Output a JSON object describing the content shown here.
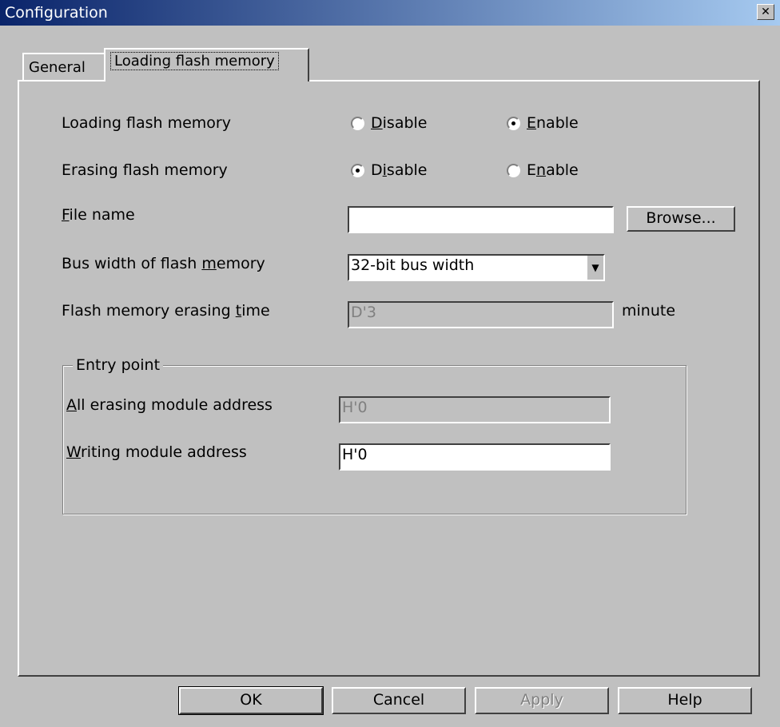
{
  "window": {
    "title": "Configuration",
    "close_glyph": "✕"
  },
  "tabs": {
    "general": "General",
    "loading_flash": "Loading flash memory"
  },
  "loading_flash_memory": {
    "label": "Loading flash memory",
    "options": {
      "disable": "Disable",
      "enable": "Enable"
    },
    "selected": "Enable"
  },
  "erasing_flash_memory": {
    "label": "Erasing flash memory",
    "options": {
      "disable": "Disable",
      "enable": "Enable"
    },
    "selected": "Disable"
  },
  "file_name": {
    "label": "File name",
    "value": "",
    "browse_label": "Browse..."
  },
  "bus_width": {
    "label": "Bus width of flash memory",
    "value": "32-bit bus width"
  },
  "erasing_time": {
    "label": "Flash memory erasing time",
    "value": "D'3",
    "unit": "minute"
  },
  "entry_point": {
    "title": "Entry point",
    "all_erasing_label": "All erasing module address",
    "all_erasing_value": "H'0",
    "writing_label": "Writing module address",
    "writing_value": "H'0"
  },
  "footer": {
    "ok": "OK",
    "cancel": "Cancel",
    "apply": "Apply",
    "help": "Help"
  }
}
